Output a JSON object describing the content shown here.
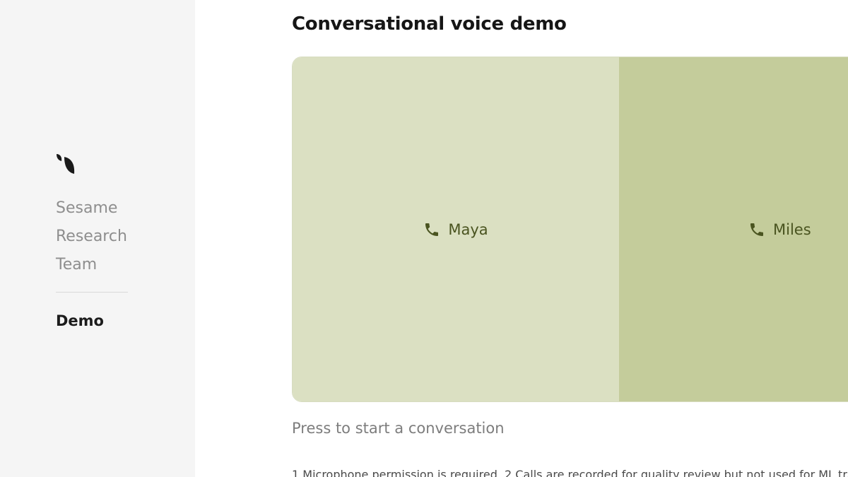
{
  "sidebar": {
    "logo_icon": "sesame-leaf-logo-icon",
    "nav_items": [
      {
        "label": "Sesame"
      },
      {
        "label": "Research"
      },
      {
        "label": "Team"
      }
    ],
    "active_item": {
      "label": "Demo"
    }
  },
  "main": {
    "title": "Conversational voice demo",
    "voices": [
      {
        "label": "Maya",
        "icon": "phone-icon"
      },
      {
        "label": "Miles",
        "icon": "phone-icon"
      }
    ],
    "caption": "Press to start a conversation",
    "footnote": "1.Microphone permission is required. 2.Calls are recorded for quality review but not used for ML training"
  },
  "colors": {
    "sidebar_bg": "#f5f5f5",
    "maya_card_bg": "#dbe0c2",
    "miles_card_bg": "#c4cc9b",
    "card_text": "#4a5420"
  }
}
